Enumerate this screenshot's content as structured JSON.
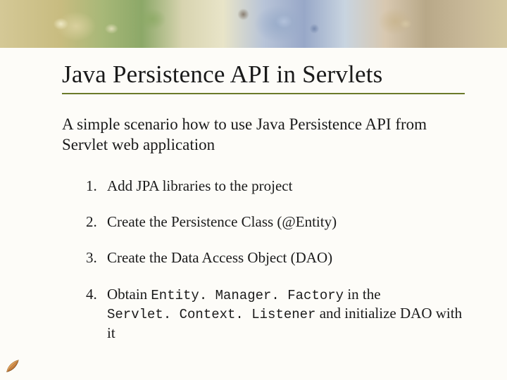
{
  "title": "Java Persistence API in Servlets",
  "intro": "A simple scenario how to use Java Persistence API from Servlet web application",
  "steps": {
    "s1": "Add JPA libraries to the project",
    "s2": "Create the Persistence Class (@Entity)",
    "s3": "Create the Data Access Object (DAO)",
    "s4_pre": "Obtain ",
    "s4_code1": "Entity. Manager. Factory",
    "s4_mid": " in the ",
    "s4_code2": "Servlet. Context. Listener",
    "s4_post": " and initialize DAO with it"
  }
}
